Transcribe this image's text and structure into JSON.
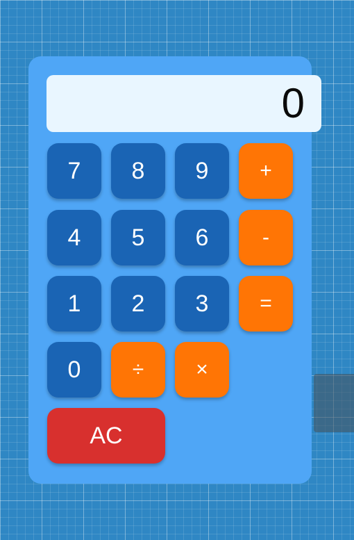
{
  "display": {
    "value": "0"
  },
  "keys": {
    "k7": "7",
    "k8": "8",
    "k9": "9",
    "plus": "+",
    "k4": "4",
    "k5": "5",
    "k6": "6",
    "minus": "-",
    "k1": "1",
    "k2": "2",
    "k3": "3",
    "equals": "=",
    "k0": "0",
    "divide": "÷",
    "multiply": "×",
    "clear": "AC"
  },
  "colors": {
    "background": "#2f87c4",
    "panel": "#4fa6f6",
    "display": "#e9f6ff",
    "number_key": "#1a64b4",
    "operator_key": "#ff7505",
    "clear_key": "#d8302e"
  }
}
